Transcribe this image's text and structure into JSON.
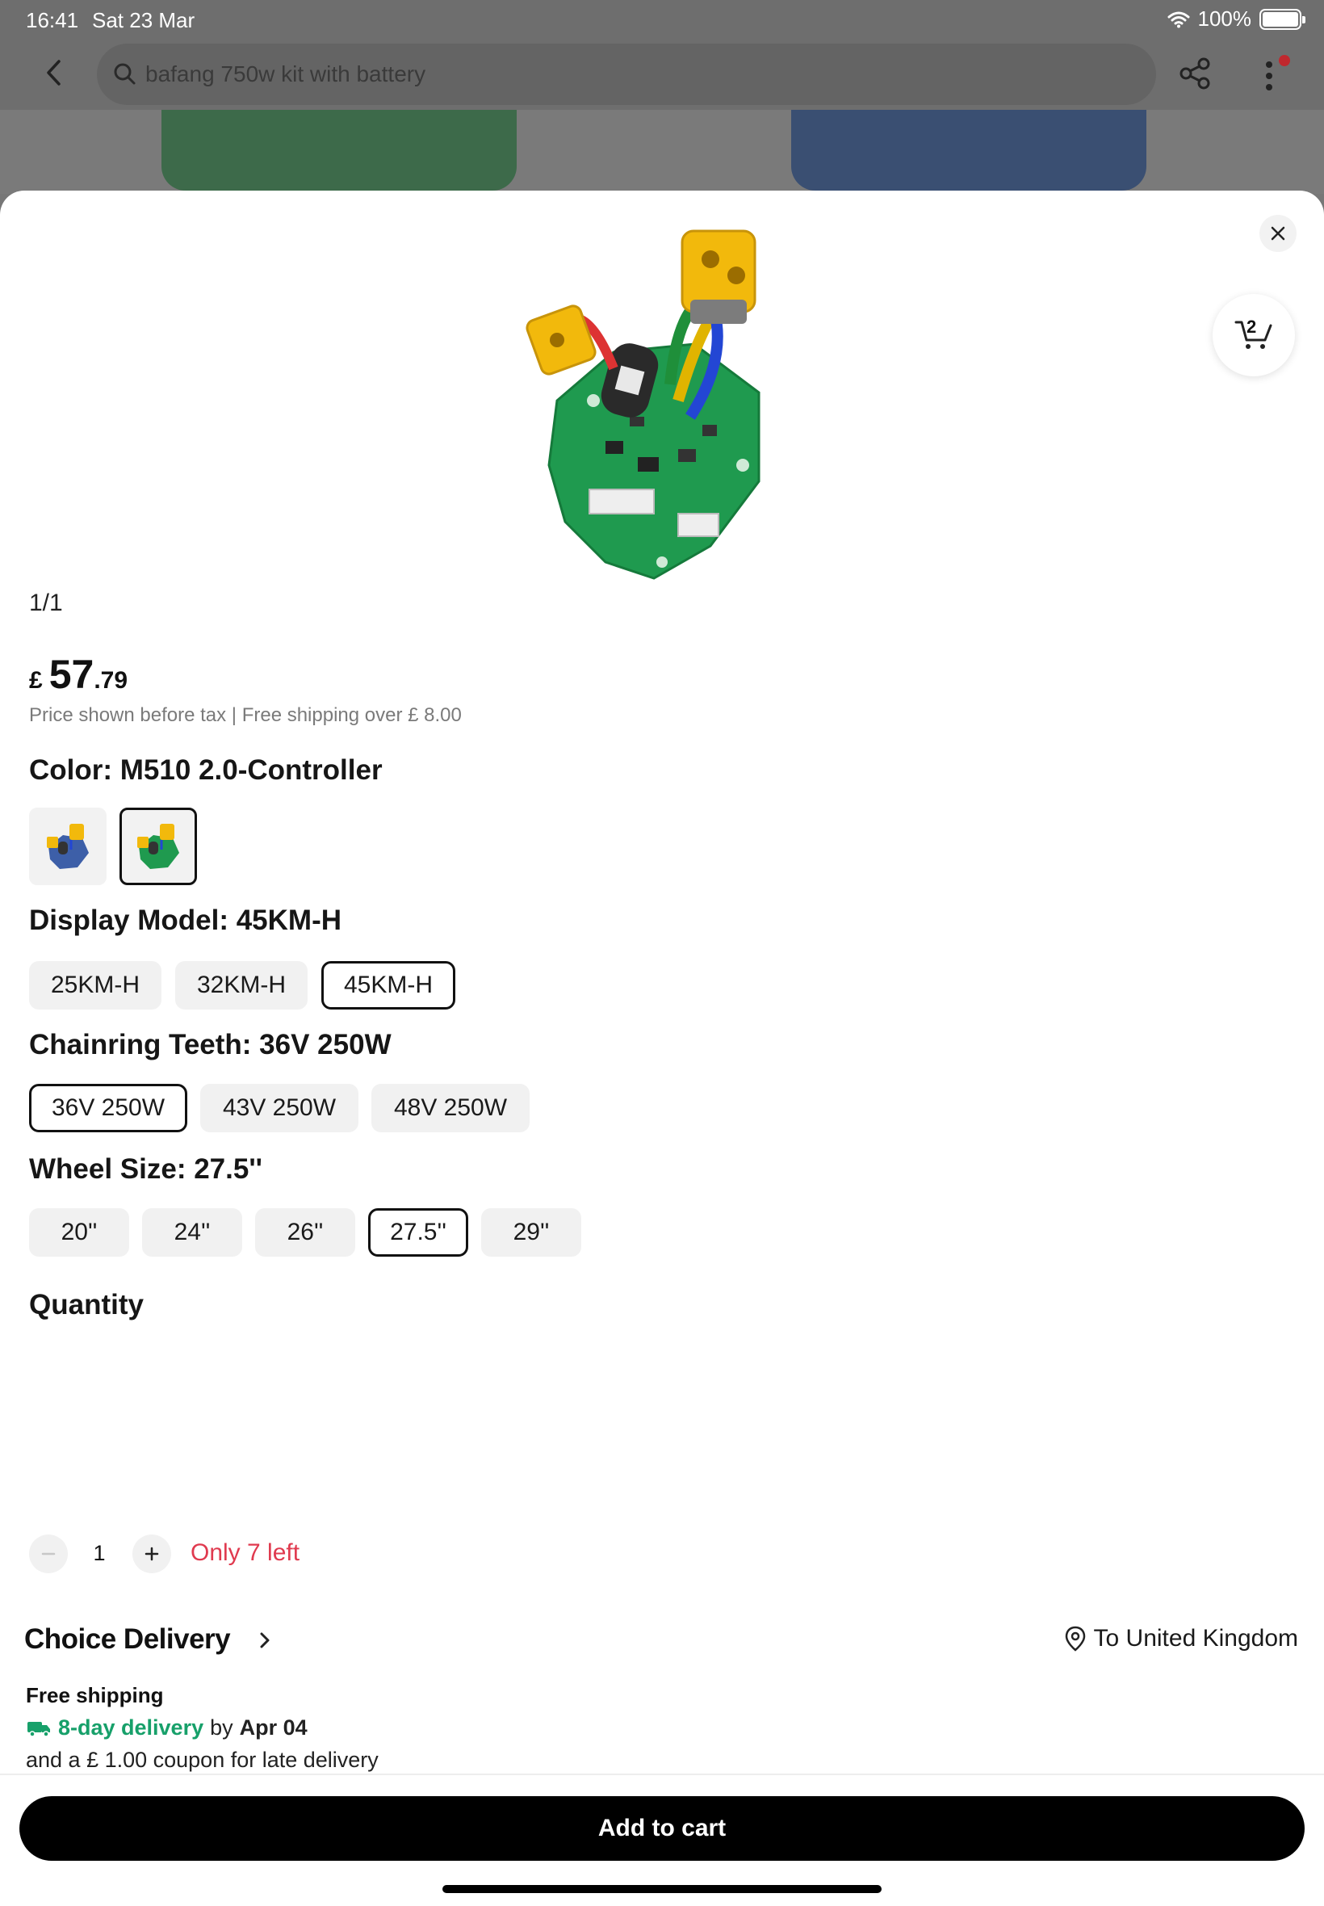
{
  "status": {
    "time": "16:41",
    "date": "Sat 23 Mar",
    "battery": "100%"
  },
  "search": {
    "query": "bafang 750w kit with battery"
  },
  "cart": {
    "count": "2"
  },
  "gallery": {
    "counter": "1/1"
  },
  "price": {
    "currency": "£",
    "integer": "57",
    "decimal": ".79",
    "note": "Price shown before tax | Free shipping over  £ 8.00"
  },
  "color": {
    "title": "Color: M510 2.0-Controller",
    "swatches": [
      {
        "name": "blue-controller"
      },
      {
        "name": "green-controller",
        "selected": true
      }
    ]
  },
  "display_model": {
    "title": "Display Model: 45KM-H",
    "options": [
      "25KM-H",
      "32KM-H",
      "45KM-H"
    ],
    "selected": "45KM-H"
  },
  "chainring": {
    "title": "Chainring Teeth: 36V 250W",
    "options": [
      "36V 250W",
      "43V 250W",
      "48V 250W"
    ],
    "selected": "36V 250W"
  },
  "wheel": {
    "title": "Wheel Size: 27.5''",
    "options": [
      "20''",
      "24''",
      "26''",
      "27.5''",
      "29''"
    ],
    "selected": "27.5''"
  },
  "quantity": {
    "title": "Quantity",
    "value": "1",
    "stock": "Only 7 left"
  },
  "delivery": {
    "title": "Choice Delivery",
    "ship_to": "To United Kingdom",
    "free_shipping": "Free shipping",
    "eta_highlight": "8-day delivery",
    "eta_by": "by",
    "eta_date": "Apr 04",
    "coupon": "and a  £ 1.00 coupon for late delivery"
  },
  "actions": {
    "add_to_cart": "Add to cart"
  },
  "colors": {
    "accent_green": "#17a06a",
    "stock_red": "#e03a4f",
    "button_black": "#000000"
  }
}
